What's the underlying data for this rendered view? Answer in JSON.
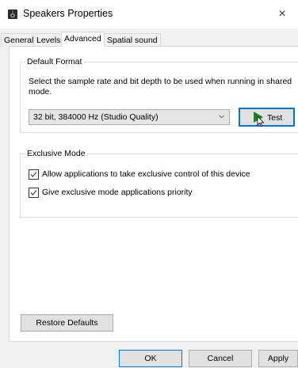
{
  "window": {
    "title": "Speakers Properties",
    "close_label": "×",
    "icon": "speaker-icon"
  },
  "tabs": [
    {
      "label": "General",
      "active": false
    },
    {
      "label": "Levels",
      "active": false
    },
    {
      "label": "Advanced",
      "active": true
    },
    {
      "label": "Spatial sound",
      "active": false
    }
  ],
  "default_format": {
    "legend": "Default Format",
    "description": "Select the sample rate and bit depth to be used when running in shared mode.",
    "selected_format": "32 bit, 384000 Hz (Studio Quality)",
    "test_label": "Test"
  },
  "exclusive_mode": {
    "legend": "Exclusive Mode",
    "options": [
      {
        "label": "Allow applications to take exclusive control of this device",
        "checked": true
      },
      {
        "label": "Give exclusive mode applications priority",
        "checked": true
      }
    ]
  },
  "restore_label": "Restore Defaults",
  "footer": {
    "ok_label": "OK",
    "cancel_label": "Cancel",
    "apply_label": "Apply"
  },
  "colors": {
    "accent": "#0078d7",
    "play": "#1e7f26"
  }
}
